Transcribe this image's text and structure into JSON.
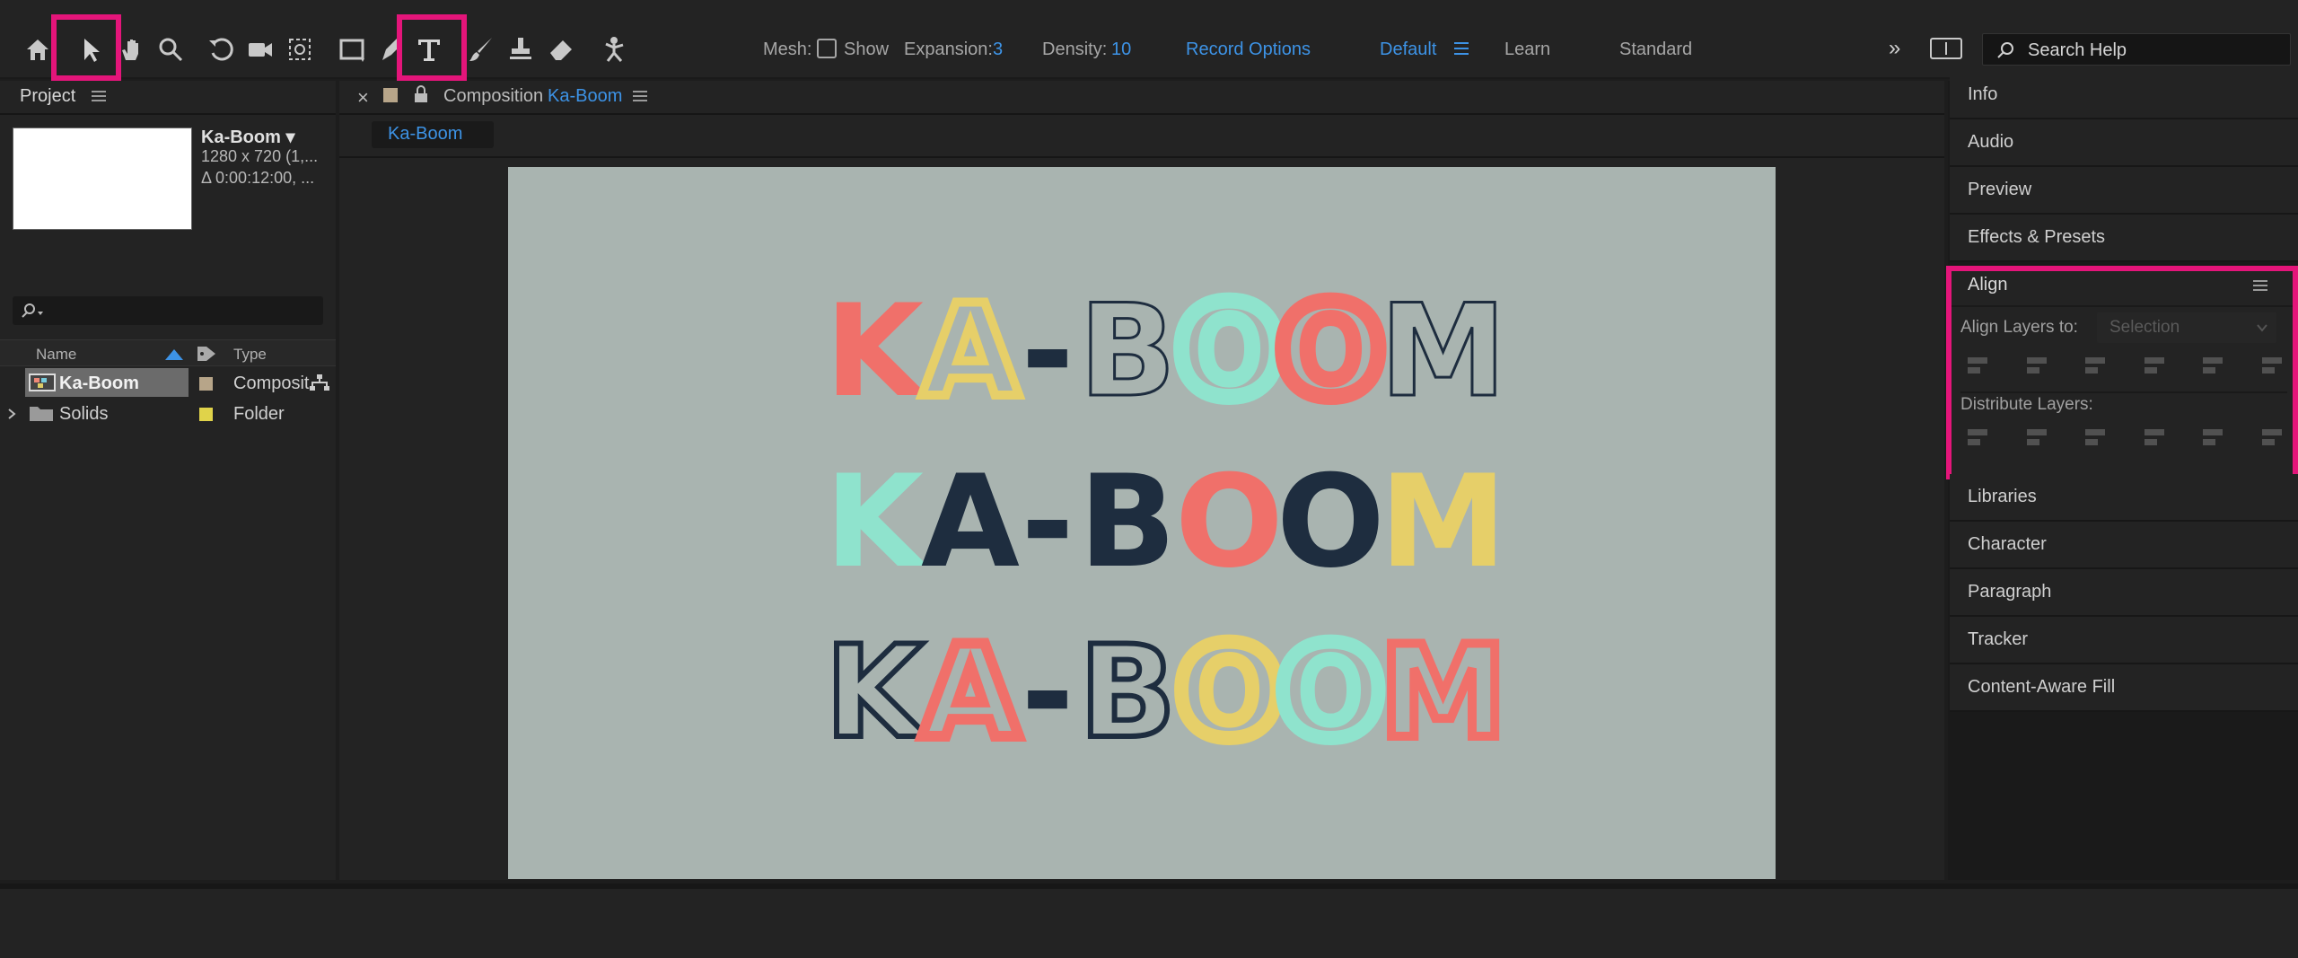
{
  "toolbar": {
    "tools": [
      {
        "name": "home-icon",
        "interactable": true
      },
      {
        "name": "selection-tool-icon",
        "interactable": true
      },
      {
        "name": "hand-tool-icon",
        "interactable": true
      },
      {
        "name": "zoom-tool-icon",
        "interactable": true
      },
      {
        "name": "rotate-tool-icon",
        "interactable": true
      },
      {
        "name": "camera-tool-icon",
        "interactable": true
      },
      {
        "name": "pan-behind-tool-icon",
        "interactable": true
      },
      {
        "name": "rectangle-tool-icon",
        "interactable": true
      },
      {
        "name": "pen-tool-icon",
        "interactable": true
      },
      {
        "name": "type-tool-icon",
        "interactable": true
      },
      {
        "name": "brush-tool-icon",
        "interactable": true
      },
      {
        "name": "clone-stamp-tool-icon",
        "interactable": true
      },
      {
        "name": "eraser-tool-icon",
        "interactable": true
      },
      {
        "name": "puppet-tool-icon",
        "interactable": true
      }
    ],
    "mesh_label": "Mesh:",
    "show_label": "Show",
    "show_checked": false,
    "expansion_label": "Expansion:",
    "expansion_value": "3",
    "density_label": "Density:",
    "density_value": "10",
    "record_options": "Record Options",
    "workspaces": [
      "Default",
      "Learn",
      "Standard"
    ],
    "active_workspace": "Default",
    "more_icon": "»",
    "search_placeholder": "Search Help"
  },
  "project": {
    "title": "Project",
    "comp_name": "Ka-Boom ▾",
    "comp_size": "1280 x 720 (1,...",
    "comp_duration": "Δ 0:00:12:00, ...",
    "columns": {
      "name": "Name",
      "type": "Type"
    },
    "items": [
      {
        "name": "Ka-Boom",
        "type": "Composit",
        "label_color": "#b7a589",
        "selected": true
      },
      {
        "name": "Solids",
        "type": "Folder",
        "label_color": "#e0d34a",
        "selected": false
      }
    ]
  },
  "composition": {
    "close": "×",
    "tab_prefix": "Composition",
    "tab_name": "Ka-Boom",
    "subtab": "Ka-Boom",
    "canvas_bg": "#a9b4b0",
    "lines": [
      {
        "text": "KA-BOOM",
        "style": "outline-mixed"
      },
      {
        "text": "KA-BOOM",
        "style": "solid"
      },
      {
        "text": "KA-BOOM",
        "style": "inline-mixed"
      }
    ]
  },
  "right_panels": {
    "top_items": [
      "Info",
      "Audio",
      "Preview",
      "Effects & Presets"
    ],
    "align": {
      "title": "Align",
      "align_to_label": "Align Layers to:",
      "align_to_value": "Selection",
      "distribute_label": "Distribute Layers:"
    },
    "bottom_items": [
      "Libraries",
      "Character",
      "Paragraph",
      "Tracker",
      "Content-Aware Fill"
    ]
  },
  "colors": {
    "accent_blue": "#3d93e6",
    "highlight": "#e4157a",
    "coral": "#f0706a",
    "mustard": "#e6cf69",
    "mint": "#8fe3cd",
    "navy": "#1e2d3f"
  }
}
